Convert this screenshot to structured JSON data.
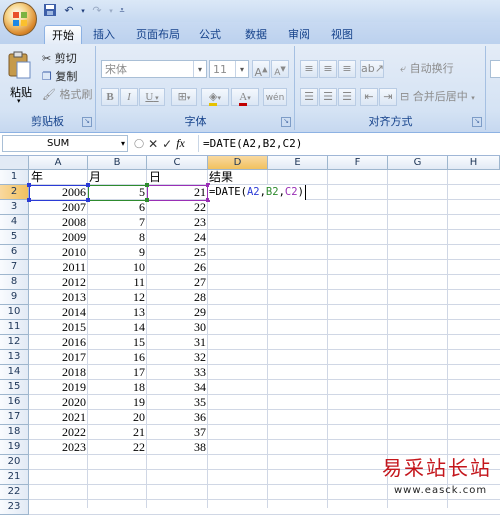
{
  "quick_access": [
    "save-icon",
    "undo-icon",
    "redo-icon",
    "customize-icon"
  ],
  "tabs": [
    "开始",
    "插入",
    "页面布局",
    "公式",
    "数据",
    "审阅",
    "视图"
  ],
  "ribbon": {
    "clipboard": {
      "paste": "粘贴",
      "cut": "剪切",
      "copy": "复制",
      "format_painter": "格式刷",
      "label": "剪贴板"
    },
    "font": {
      "font_name": "宋体",
      "font_size": "11",
      "bold": "B",
      "italic": "I",
      "underline": "U",
      "label": "字体"
    },
    "alignment": {
      "wrap_text": "自动换行",
      "merge_center": "合并后居中",
      "label": "对齐方式"
    }
  },
  "formula_bar": {
    "name_box": "SUM",
    "cancel": "✕",
    "enter": "✓",
    "fx": "fx",
    "formula": "=DATE(A2,B2,C2)"
  },
  "columns": [
    "A",
    "B",
    "C",
    "D",
    "E",
    "F",
    "G",
    "H"
  ],
  "rows": [
    "1",
    "2",
    "3",
    "4",
    "5",
    "6",
    "7",
    "8",
    "9",
    "10",
    "11",
    "12",
    "13",
    "14",
    "15",
    "16",
    "17",
    "18",
    "19",
    "20",
    "21",
    "22",
    "23"
  ],
  "headers": {
    "a": "年",
    "b": "月",
    "c": "日",
    "d": "结果"
  },
  "data": [
    [
      "2006",
      "5",
      "21"
    ],
    [
      "2007",
      "6",
      "22"
    ],
    [
      "2008",
      "7",
      "23"
    ],
    [
      "2009",
      "8",
      "24"
    ],
    [
      "2010",
      "9",
      "25"
    ],
    [
      "2011",
      "10",
      "26"
    ],
    [
      "2012",
      "11",
      "27"
    ],
    [
      "2013",
      "12",
      "28"
    ],
    [
      "2014",
      "13",
      "29"
    ],
    [
      "2015",
      "14",
      "30"
    ],
    [
      "2016",
      "15",
      "31"
    ],
    [
      "2017",
      "16",
      "32"
    ],
    [
      "2018",
      "17",
      "33"
    ],
    [
      "2019",
      "18",
      "34"
    ],
    [
      "2020",
      "19",
      "35"
    ],
    [
      "2021",
      "20",
      "36"
    ],
    [
      "2022",
      "21",
      "37"
    ],
    [
      "2023",
      "22",
      "38"
    ]
  ],
  "editing_cell": {
    "prefix": "=DATE(",
    "a": "A2",
    "sep1": ",",
    "b": "B2",
    "sep2": ",",
    "c": "C2",
    "suffix": ")"
  },
  "ref_colors": {
    "a": "#2b3bd6",
    "b": "#2e8b2e",
    "c": "#9a2fb5"
  },
  "watermark": {
    "cn": "易采站长站",
    "url": "www.easck.com"
  }
}
